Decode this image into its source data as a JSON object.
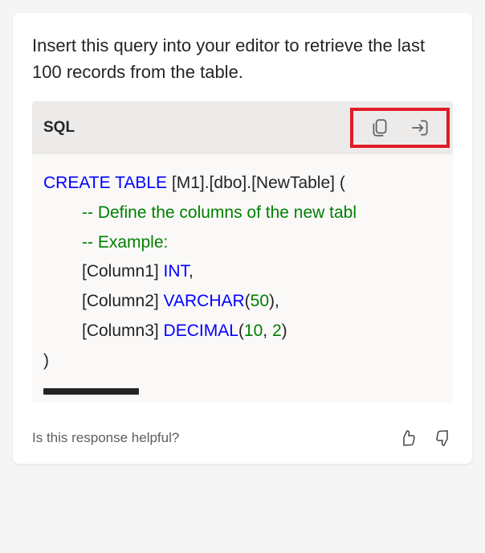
{
  "intro": "Insert this query into your editor to retrieve the last 100 records from the table.",
  "code": {
    "lang": "SQL",
    "tokens": {
      "create": "CREATE TABLE",
      "tableName": " [M1].[dbo].[NewTable] (",
      "comment1": "-- Define the columns of the new tabl",
      "comment2": "-- Example:",
      "col1_name": "[Column1] ",
      "col1_type": "INT",
      "col1_tail": ",",
      "col2_name": "[Column2] ",
      "col2_type": "VARCHAR",
      "col2_open": "(",
      "col2_num": "50",
      "col2_close": "),",
      "col3_name": "[Column3] ",
      "col3_type": "DECIMAL",
      "col3_open": "(",
      "col3_num1": "10",
      "col3_sep": ", ",
      "col3_num2": "2",
      "col3_close": ")",
      "end": ")"
    }
  },
  "feedback": {
    "prompt": "Is this response helpful?"
  }
}
